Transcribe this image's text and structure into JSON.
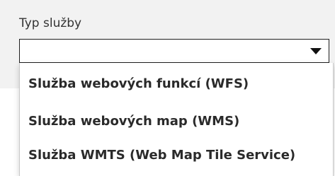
{
  "field": {
    "label": "Typ služby",
    "selected_value": ""
  },
  "dropdown": {
    "options": [
      "Služba webových funkcí (WFS)",
      "Služba webových map (WMS)",
      "Služba WMTS (Web Map Tile Service)"
    ]
  },
  "icons": {
    "select_caret": "caret-down-icon"
  }
}
